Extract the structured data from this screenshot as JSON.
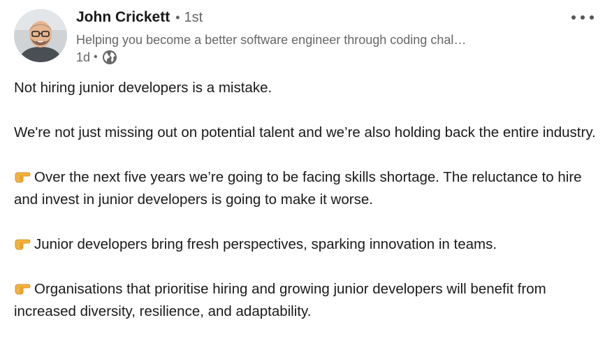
{
  "author": {
    "name": "John Crickett",
    "separator": "•",
    "degree": "1st",
    "headline": "Helping you become a better software engineer through coding chal…",
    "time": "1d",
    "time_separator": "•",
    "visibility_icon": "globe-icon"
  },
  "menu": {
    "icon": "more-horizontal-icon"
  },
  "post": {
    "paragraphs": [
      {
        "text": "Not hiring junior developers is a mistake.",
        "emoji": ""
      },
      {
        "text": "We're not just missing out on potential talent and we’re also holding back the entire industry.",
        "emoji": ""
      },
      {
        "text": "Over the next five years we’re going to be facing skills shortage. The reluctance to hire and invest in junior developers is going to make it worse.",
        "emoji": "backhand-index-pointing-right"
      },
      {
        "text": "Junior developers bring fresh perspectives, sparking innovation in teams.",
        "emoji": "backhand-index-pointing-right"
      },
      {
        "text": "Organisations that prioritise hiring and growing junior developers will benefit from increased diversity, resilience, and adaptability.",
        "emoji": "backhand-index-pointing-right"
      }
    ]
  },
  "colors": {
    "primary_text": "#191919",
    "secondary_text": "#666666",
    "background": "#ffffff",
    "emoji": "#f5b23c"
  }
}
